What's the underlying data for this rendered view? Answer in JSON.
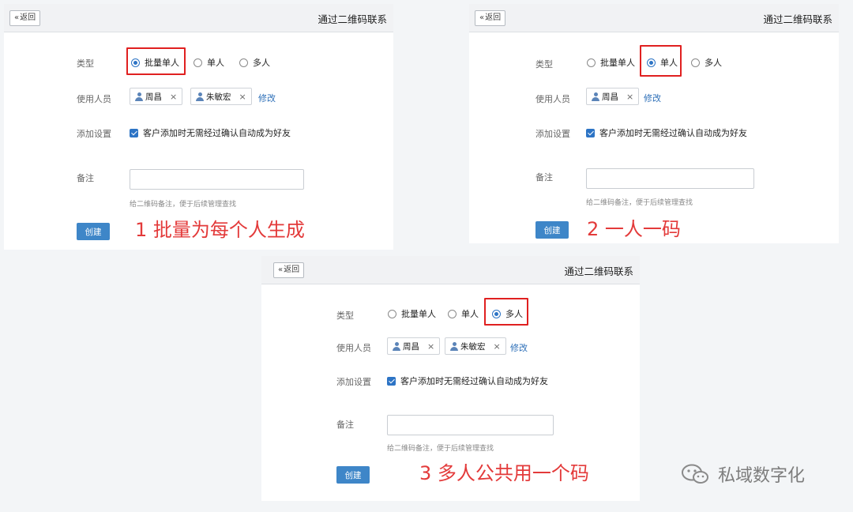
{
  "back_label": "返回",
  "window_title": "通过二维码联系",
  "form_labels": {
    "type": "类型",
    "users": "使用人员",
    "settings": "添加设置",
    "note": "备注"
  },
  "type_options": [
    "批量单人",
    "单人",
    "多人"
  ],
  "users": {
    "zhou": "周昌",
    "zhu": "朱敏宏",
    "remove_glyph": "×",
    "edit_link": "修改"
  },
  "auto_friend_label": "客户添加时无需经过确认自动成为好友",
  "note_hint": "给二维码备注，便于后续管理查找",
  "create_label": "创建",
  "panels": [
    {
      "selected_option": "批量单人",
      "caption": "1  批量为每个人生成"
    },
    {
      "selected_option": "单人",
      "caption": "2  一人一码"
    },
    {
      "selected_option": "多人",
      "caption": "3  多人公共用一个码"
    }
  ],
  "watermark": {
    "icon": "wechat-icon",
    "text": "私域数字化"
  },
  "colors": {
    "accent": "#2d74c5",
    "highlight": "#e02020",
    "caption": "#e33a3a"
  }
}
